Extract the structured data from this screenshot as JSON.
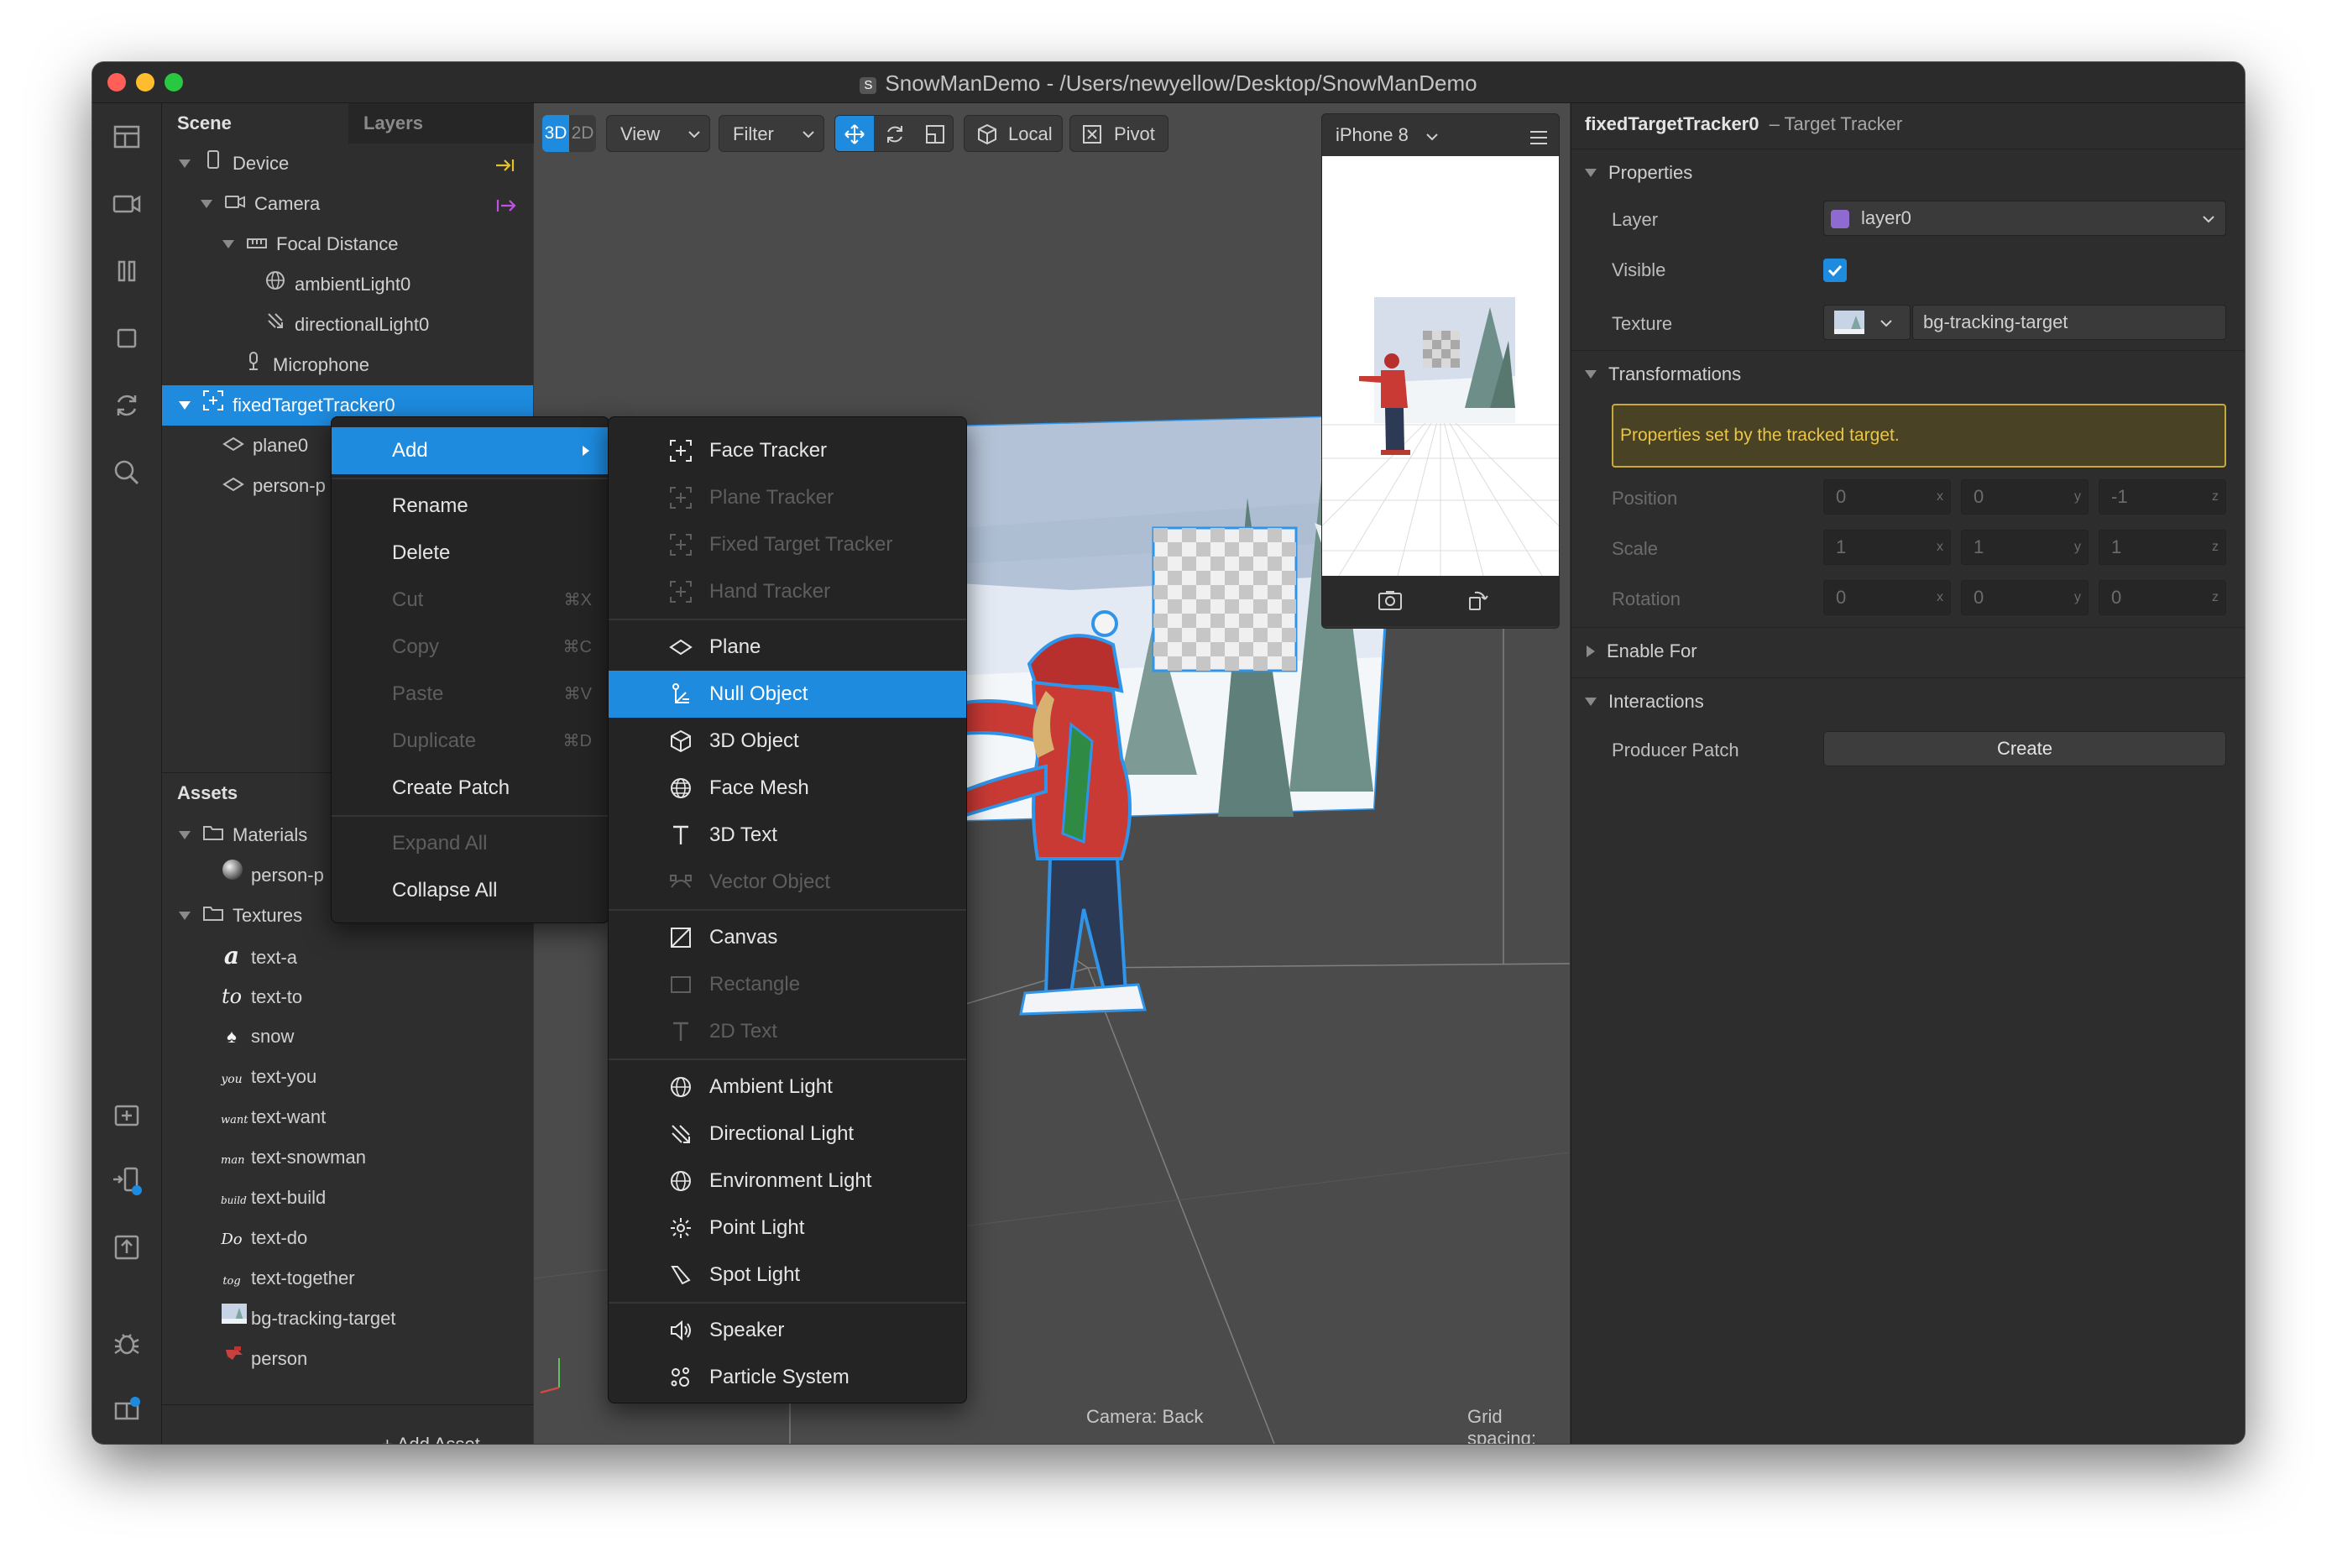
{
  "window": {
    "title": "SnowManDemo - /Users/newyellow/Desktop/SnowManDemo",
    "app_icon_glyph": "S"
  },
  "left_rail": {
    "icons": [
      "layout-icon",
      "video-camera-icon",
      "pause-columns-icon",
      "square-icon",
      "refresh-icon",
      "search-icon",
      "add-folder-icon",
      "device-preview-icon",
      "upload-icon",
      "bug-icon",
      "book-icon"
    ]
  },
  "scene_panel": {
    "tabs": [
      "Scene",
      "Layers"
    ],
    "tree": [
      {
        "label": "Device",
        "icon": "phone-icon"
      },
      {
        "label": "Camera",
        "icon": "camera-icon"
      },
      {
        "label": "Focal Distance",
        "icon": "focal-distance-icon"
      },
      {
        "label": "ambientLight0",
        "icon": "globe-icon"
      },
      {
        "label": "directionalLight0",
        "icon": "directional-light-icon"
      },
      {
        "label": "Microphone",
        "icon": "microphone-icon"
      },
      {
        "label": "fixedTargetTracker0",
        "icon": "target-tracker-icon"
      },
      {
        "label": "plane0",
        "icon": "plane-icon"
      },
      {
        "label": "person-p",
        "icon": "plane-icon"
      }
    ]
  },
  "assets_panel": {
    "title": "Assets",
    "folders": [
      {
        "label": "Materials",
        "items": [
          {
            "label": "person-p",
            "icon": "sphere-material-icon"
          }
        ]
      },
      {
        "label": "Textures",
        "items": [
          {
            "label": "text-a",
            "thumb": "a"
          },
          {
            "label": "text-to",
            "thumb": "to"
          },
          {
            "label": "snow",
            "thumb": "♠"
          },
          {
            "label": "text-you",
            "thumb": "you"
          },
          {
            "label": "text-want",
            "thumb": "want"
          },
          {
            "label": "text-snowman",
            "thumb": "man"
          },
          {
            "label": "text-build",
            "thumb": "build"
          },
          {
            "label": "text-do",
            "thumb": "Do"
          },
          {
            "label": "text-together",
            "thumb": "tog"
          },
          {
            "label": "bg-tracking-target",
            "thumb": "img"
          },
          {
            "label": "person",
            "thumb": "img"
          }
        ]
      }
    ],
    "add_asset_label": "+ Add Asset"
  },
  "toolbar": {
    "mode_3d": "3D",
    "mode_2d": "2D",
    "view_label": "View",
    "filter_label": "Filter",
    "local_label": "Local",
    "pivot_label": "Pivot"
  },
  "viewport": {
    "camera_label": "Camera: Back",
    "grid_label": "Grid spacing:"
  },
  "simulator": {
    "device_label": "iPhone 8"
  },
  "context_menu": {
    "items": [
      {
        "label": "Add",
        "state": "selected",
        "has_submenu": true
      },
      {
        "label": "Rename",
        "state": "enabled"
      },
      {
        "label": "Delete",
        "state": "enabled"
      },
      {
        "label": "Cut",
        "shortcut": "⌘X",
        "state": "disabled"
      },
      {
        "label": "Copy",
        "shortcut": "⌘C",
        "state": "disabled"
      },
      {
        "label": "Paste",
        "shortcut": "⌘V",
        "state": "disabled"
      },
      {
        "label": "Duplicate",
        "shortcut": "⌘D",
        "state": "disabled"
      },
      {
        "label": "Create Patch",
        "state": "enabled"
      },
      {
        "label": "Expand All",
        "state": "disabled"
      },
      {
        "label": "Collapse All",
        "state": "enabled"
      }
    ]
  },
  "add_submenu": {
    "items": [
      {
        "label": "Face Tracker",
        "icon": "face-tracker-icon",
        "state": "enabled"
      },
      {
        "label": "Plane Tracker",
        "icon": "plane-tracker-icon",
        "state": "disabled"
      },
      {
        "label": "Fixed Target Tracker",
        "icon": "target-tracker-icon",
        "state": "disabled"
      },
      {
        "label": "Hand Tracker",
        "icon": "hand-tracker-icon",
        "state": "disabled"
      },
      {
        "label": "Plane",
        "icon": "plane-icon",
        "state": "enabled"
      },
      {
        "label": "Null Object",
        "icon": "null-object-icon",
        "state": "selected"
      },
      {
        "label": "3D Object",
        "icon": "cube-icon",
        "state": "enabled"
      },
      {
        "label": "Face Mesh",
        "icon": "face-mesh-icon",
        "state": "enabled"
      },
      {
        "label": "3D Text",
        "icon": "text-icon",
        "state": "enabled"
      },
      {
        "label": "Vector Object",
        "icon": "vector-icon",
        "state": "disabled"
      },
      {
        "label": "Canvas",
        "icon": "canvas-icon",
        "state": "enabled"
      },
      {
        "label": "Rectangle",
        "icon": "rectangle-icon",
        "state": "disabled"
      },
      {
        "label": "2D Text",
        "icon": "text-icon",
        "state": "disabled"
      },
      {
        "label": "Ambient Light",
        "icon": "globe-icon",
        "state": "enabled"
      },
      {
        "label": "Directional Light",
        "icon": "directional-light-icon",
        "state": "enabled"
      },
      {
        "label": "Environment Light",
        "icon": "globe-icon",
        "state": "enabled"
      },
      {
        "label": "Point Light",
        "icon": "point-light-icon",
        "state": "enabled"
      },
      {
        "label": "Spot Light",
        "icon": "spot-light-icon",
        "state": "enabled"
      },
      {
        "label": "Speaker",
        "icon": "speaker-icon",
        "state": "enabled"
      },
      {
        "label": "Particle System",
        "icon": "particle-icon",
        "state": "enabled"
      }
    ]
  },
  "inspector": {
    "object_name": "fixedTargetTracker0",
    "object_type": "– Target Tracker",
    "properties_title": "Properties",
    "layer_label": "Layer",
    "layer_value": "layer0",
    "layer_color": "#8f6bd1",
    "visible_label": "Visible",
    "visible_checked": true,
    "texture_label": "Texture",
    "texture_value": "bg-tracking-target",
    "transformations_title": "Transformations",
    "notice": "Properties set by the tracked target.",
    "transforms": [
      {
        "label": "Position",
        "values": [
          "0",
          "0",
          "-1"
        ]
      },
      {
        "label": "Scale",
        "values": [
          "1",
          "1",
          "1"
        ]
      },
      {
        "label": "Rotation",
        "values": [
          "0",
          "0",
          "0"
        ]
      }
    ],
    "enable_for_title": "Enable For",
    "interactions_title": "Interactions",
    "producer_patch_label": "Producer Patch",
    "create_label": "Create"
  },
  "colors": {
    "accent": "#1e8bdf",
    "notice_bg": "#4a4224",
    "notice_border": "#c8a93a",
    "notice_text": "#e9c64a"
  }
}
